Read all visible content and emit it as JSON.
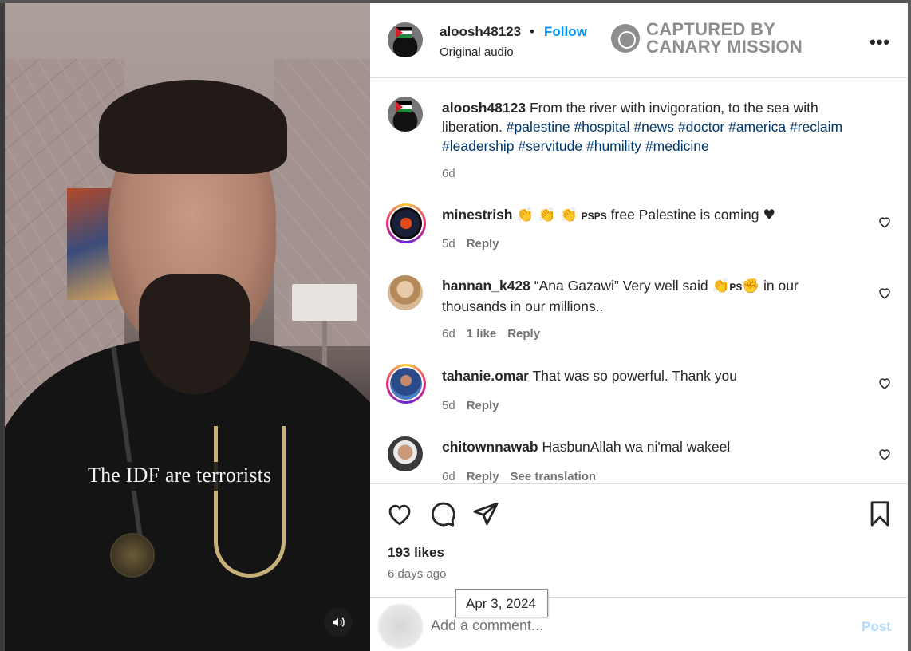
{
  "post": {
    "author": "aloosh48123",
    "dot": "•",
    "follow_label": "Follow",
    "audio": "Original audio",
    "more_label": "•••",
    "caption_text": "From the river with invigoration, to the sea with liberation.",
    "hashtags": [
      "#palestine",
      "#hospital",
      "#news",
      "#doctor",
      "#america",
      "#reclaim",
      "#leadership",
      "#servitude",
      "#humility",
      "#medicine"
    ],
    "age": "6d"
  },
  "watermark": {
    "line1": "CAPTURED BY",
    "line2": "CANARY MISSION"
  },
  "video": {
    "overlay_caption": "The IDF are terrorists",
    "mute_icon": "speaker-icon"
  },
  "comments": [
    {
      "user": "minestrish",
      "emoji": "👏 👏 👏",
      "emoji2": "PSPS",
      "text": "free Palestine is coming",
      "emoji3": "♥",
      "age": "5d",
      "likes": "",
      "reply": "Reply",
      "translate": ""
    },
    {
      "user": "hannan_k428",
      "text": "“Ana Gazawi” Very well said",
      "emoji": "👏",
      "emoji2": "PS",
      "emoji3": "✊",
      "text2": "in our thousands in our millions..",
      "age": "6d",
      "likes": "1 like",
      "reply": "Reply",
      "translate": ""
    },
    {
      "user": "tahanie.omar",
      "text": "That was so powerful. Thank you",
      "age": "5d",
      "likes": "",
      "reply": "Reply",
      "translate": ""
    },
    {
      "user": "chitownnawab",
      "text": "HasbunAllah wa ni'mal wakeel",
      "age": "6d",
      "likes": "",
      "reply": "Reply",
      "translate": "See translation"
    }
  ],
  "engagement": {
    "likes": "193 likes",
    "posted": "6 days ago",
    "tooltip": "Apr 3, 2024"
  },
  "composer": {
    "placeholder": "Add a comment...",
    "post_label": "Post"
  },
  "colors": {
    "link": "#0095f6",
    "hashtag": "#00376b",
    "muted": "#737373"
  }
}
